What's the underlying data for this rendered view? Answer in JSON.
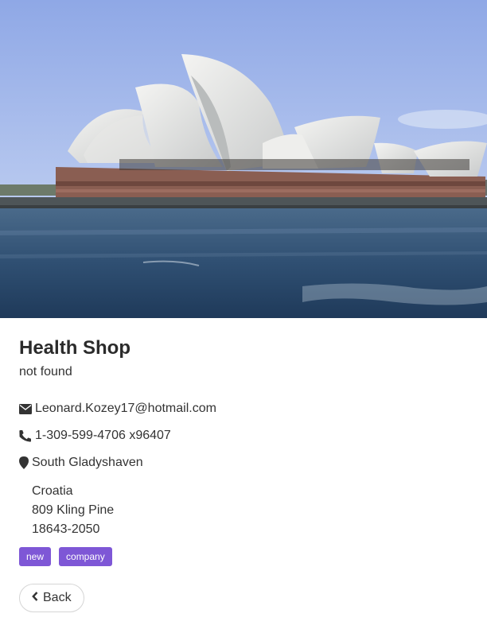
{
  "hero": {
    "alt": "Sydney Opera House"
  },
  "shop": {
    "name": "Health Shop",
    "status": "not found"
  },
  "contact": {
    "email": "Leonard.Kozey17@hotmail.com",
    "email_icon": "envelope-icon",
    "phone": "1-309-599-4706 x96407",
    "phone_icon": "phone-icon",
    "city": "South Gladyshaven",
    "city_icon": "map-marker-icon"
  },
  "address": {
    "country": "Croatia",
    "street": "809 Kling Pine",
    "postal_code": "18643-2050"
  },
  "tags": [
    {
      "label": "new"
    },
    {
      "label": "company"
    }
  ],
  "back_button": {
    "label": "Back",
    "icon": "chevron-left-icon"
  },
  "colors": {
    "tag_bg": "#7e57d6",
    "text": "#333333"
  }
}
